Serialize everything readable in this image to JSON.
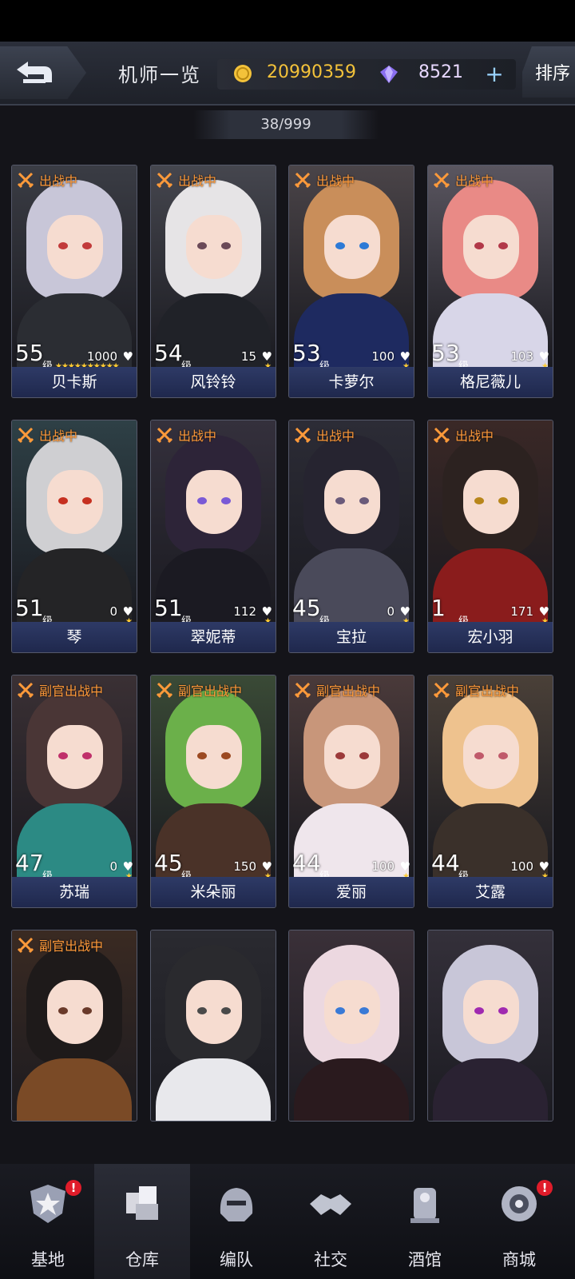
{
  "header": {
    "title": "机师一览",
    "coins": "20990359",
    "gems": "8521",
    "add_label": "+",
    "sort_label": "排序",
    "count": "38/999"
  },
  "colors": {
    "coin": "#f3c23a",
    "deploy_tag": "#ff9a3a",
    "name_bar": "#2e3a66",
    "badge": "#e01c2a"
  },
  "pilots": [
    {
      "name": "贝卡斯",
      "level": "55",
      "level_unit": "级",
      "affection": "1000",
      "stars": "★★★★★★★★★★",
      "status": "出战中",
      "hair": "#c8c6d8",
      "outfit": "#2b2d33",
      "eye": "#c23a3a",
      "bg": "#3a3c44"
    },
    {
      "name": "风铃铃",
      "level": "54",
      "level_unit": "级",
      "affection": "15",
      "stars": "★",
      "status": "出战中",
      "hair": "#e6e4e6",
      "outfit": "#202228",
      "eye": "#6b4a58",
      "bg": "#45464e"
    },
    {
      "name": "卡萝尔",
      "level": "53",
      "level_unit": "级",
      "affection": "100",
      "stars": "★",
      "status": "出战中",
      "hair": "#c98e5a",
      "outfit": "#1e2a60",
      "eye": "#2d7ad6",
      "bg": "#4a4448"
    },
    {
      "name": "格尼薇儿",
      "level": "53",
      "level_unit": "级",
      "affection": "103",
      "stars": "★",
      "status": "出战中",
      "hair": "#e98a86",
      "outfit": "#d8d6e8",
      "eye": "#b23848",
      "bg": "#5a5660"
    },
    {
      "name": "琴",
      "level": "51",
      "level_unit": "级",
      "affection": "0",
      "stars": "★",
      "status": "出战中",
      "hair": "#cfcfd2",
      "outfit": "#242426",
      "eye": "#c63020",
      "bg": "#2e4046"
    },
    {
      "name": "翠妮蒂",
      "level": "51",
      "level_unit": "级",
      "affection": "112",
      "stars": "★",
      "status": "出战中",
      "hair": "#2d2438",
      "outfit": "#1b1a22",
      "eye": "#7a5ad6",
      "bg": "#34303c"
    },
    {
      "name": "宝拉",
      "level": "45",
      "level_unit": "级",
      "affection": "0",
      "stars": "★",
      "status": "出战中",
      "hair": "#262430",
      "outfit": "#4a4a5a",
      "eye": "#6a5a7a",
      "bg": "#2c2c36"
    },
    {
      "name": "宏小羽",
      "level": "1",
      "level_unit": "级",
      "affection": "171",
      "stars": "★",
      "status": "出战中",
      "hair": "#2c2220",
      "outfit": "#8a1c1c",
      "eye": "#b8861a",
      "bg": "#3a2826"
    },
    {
      "name": "苏瑞",
      "level": "47",
      "level_unit": "级",
      "affection": "0",
      "stars": "★",
      "status": "副官出战中",
      "hair": "#4a3636",
      "outfit": "#2c8a84",
      "eye": "#c0306a",
      "bg": "#3a3034"
    },
    {
      "name": "米朵丽",
      "level": "45",
      "level_unit": "级",
      "affection": "150",
      "stars": "★",
      "status": "副官出战中",
      "hair": "#6bb04a",
      "outfit": "#4a3228",
      "eye": "#9c4a22",
      "bg": "#3a4a36"
    },
    {
      "name": "爱丽",
      "level": "44",
      "level_unit": "级",
      "affection": "100",
      "stars": "★",
      "status": "副官出战中",
      "hair": "#c8967a",
      "outfit": "#efe6ec",
      "eye": "#9c3a3a",
      "bg": "#4a3a3a"
    },
    {
      "name": "艾露",
      "level": "44",
      "level_unit": "级",
      "affection": "100",
      "stars": "★",
      "status": "副官出战中",
      "hair": "#eec28e",
      "outfit": "#3a302a",
      "eye": "#c05a6a",
      "bg": "#4a4038"
    },
    {
      "name": "",
      "level": "",
      "level_unit": "",
      "affection": "",
      "stars": "",
      "status": "副官出战中",
      "hair": "#1e1a1a",
      "outfit": "#7a4a26",
      "eye": "#6a3a2a",
      "bg": "#3a2a22"
    },
    {
      "name": "",
      "level": "",
      "level_unit": "",
      "affection": "",
      "stars": "",
      "status": "",
      "hair": "#2a2a2e",
      "outfit": "#e8e8ec",
      "eye": "#4a4a4a",
      "bg": "#2a2a30"
    },
    {
      "name": "",
      "level": "",
      "level_unit": "",
      "affection": "",
      "stars": "",
      "status": "",
      "hair": "#ecd8e0",
      "outfit": "#2a1a1e",
      "eye": "#3a7ad6",
      "bg": "#3a3038"
    },
    {
      "name": "",
      "level": "",
      "level_unit": "",
      "affection": "",
      "stars": "",
      "status": "",
      "hair": "#c8c6d8",
      "outfit": "#2a2232",
      "eye": "#a02ab0",
      "bg": "#34303a"
    }
  ],
  "nav": [
    {
      "label": "基地",
      "icon": "star-shield-icon",
      "badge": "!",
      "active": false
    },
    {
      "label": "仓库",
      "icon": "warehouse-icon",
      "badge": "",
      "active": true
    },
    {
      "label": "编队",
      "icon": "mech-head-icon",
      "badge": "",
      "active": false
    },
    {
      "label": "社交",
      "icon": "handshake-icon",
      "badge": "",
      "active": false
    },
    {
      "label": "酒馆",
      "icon": "tavern-icon",
      "badge": "",
      "active": false
    },
    {
      "label": "商城",
      "icon": "shop-icon",
      "badge": "!",
      "active": false
    }
  ]
}
